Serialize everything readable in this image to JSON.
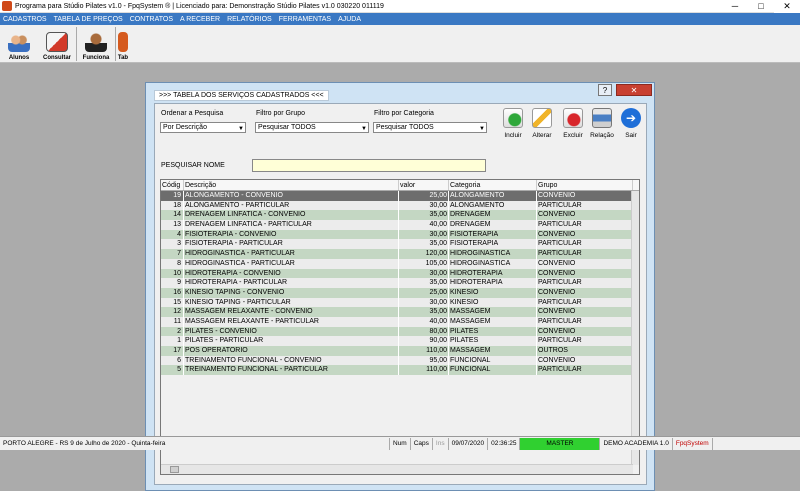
{
  "window": {
    "title": "Programa para Stúdio Pilates v1.0 - FpqSystem ® | Licenciado para: Demonstração Stúdio Pilates v1.0 030220 011119"
  },
  "menu": [
    "CADASTROS",
    "TABELA DE PREÇOS",
    "CONTRATOS",
    "A RECEBER",
    "RELATÓRIOS",
    "FERRAMENTAS",
    "AJUDA"
  ],
  "toolbar": [
    "Alunos",
    "Consultar",
    "Funciona",
    "Tab"
  ],
  "dialog": {
    "caption": ">>>  TABELA DOS SERVIÇOS CADASTRADOS  <<<",
    "help": "?",
    "close": "✕",
    "order_label": "Ordenar a Pesquisa",
    "order_value": "Por Descrição",
    "group_label": "Filtro por Grupo",
    "group_value": "Pesquisar TODOS",
    "category_label": "Filtro por Categoria",
    "category_value": "Pesquisar TODOS",
    "search_label": "PESQUISAR NOME",
    "search_value": "",
    "actions": [
      "Incluir",
      "Alterar",
      "Excluir",
      "Relação",
      "Sair"
    ]
  },
  "grid": {
    "columns": [
      "Códig",
      "Descrição",
      "valor",
      "Categoria",
      "Grupo"
    ],
    "rows": [
      {
        "code": "19",
        "desc": "ALONGAMENTO - CONVENIO",
        "value": "25,00",
        "cat": "ALONGAMENTO",
        "group": "CONVENIO"
      },
      {
        "code": "18",
        "desc": "ALONGAMENTO - PARTICULAR",
        "value": "30,00",
        "cat": "ALONGAMENTO",
        "group": "PARTICULAR"
      },
      {
        "code": "14",
        "desc": "DRENAGEM LINFATICA - CONVENIO",
        "value": "35,00",
        "cat": "DRENAGEM",
        "group": "CONVENIO"
      },
      {
        "code": "13",
        "desc": "DRENAGEM LINFATICA - PARTICULAR",
        "value": "40,00",
        "cat": "DRENAGEM",
        "group": "PARTICULAR"
      },
      {
        "code": "4",
        "desc": "FISIOTERAPIA - CONVENIO",
        "value": "30,00",
        "cat": "FISIOTERAPIA",
        "group": "CONVENIO"
      },
      {
        "code": "3",
        "desc": "FISIOTERAPIA - PARTICULAR",
        "value": "35,00",
        "cat": "FISIOTERAPIA",
        "group": "PARTICULAR"
      },
      {
        "code": "7",
        "desc": "HIDROGINASTICA - PARTICULAR",
        "value": "120,00",
        "cat": "HIDROGINASTICA",
        "group": "PARTICULAR"
      },
      {
        "code": "8",
        "desc": "HIDROGINASTICA - PARTICULAR",
        "value": "105,00",
        "cat": "HIDROGINASTICA",
        "group": "CONVENIO"
      },
      {
        "code": "10",
        "desc": "HIDROTERAPIA - CONVENIO",
        "value": "30,00",
        "cat": "HIDROTERAPIA",
        "group": "CONVENIO"
      },
      {
        "code": "9",
        "desc": "HIDROTERAPIA - PARTICULAR",
        "value": "35,00",
        "cat": "HIDROTERAPIA",
        "group": "PARTICULAR"
      },
      {
        "code": "16",
        "desc": "KINESIO TAPING - CONVENIO",
        "value": "25,00",
        "cat": "KINESIO",
        "group": "CONVENIO"
      },
      {
        "code": "15",
        "desc": "KINESIO TAPING - PARTICULAR",
        "value": "30,00",
        "cat": "KINESIO",
        "group": "PARTICULAR"
      },
      {
        "code": "12",
        "desc": "MASSAGEM RELAXANTE - CONVENIO",
        "value": "35,00",
        "cat": "MASSAGEM",
        "group": "CONVENIO"
      },
      {
        "code": "11",
        "desc": "MASSAGEM RELAXANTE - PARTICULAR",
        "value": "40,00",
        "cat": "MASSAGEM",
        "group": "PARTICULAR"
      },
      {
        "code": "2",
        "desc": "PILATES - CONVENIO",
        "value": "80,00",
        "cat": "PILATES",
        "group": "CONVENIO"
      },
      {
        "code": "1",
        "desc": "PILATES - PARTICULAR",
        "value": "90,00",
        "cat": "PILATES",
        "group": "PARTICULAR"
      },
      {
        "code": "17",
        "desc": "POS OPERATORIO",
        "value": "110,00",
        "cat": "MASSAGEM",
        "group": "OUTROS"
      },
      {
        "code": "6",
        "desc": "TREINAMENTO FUNCIONAL - CONVENIO",
        "value": "95,00",
        "cat": "FUNCIONAL",
        "group": "CONVENIO"
      },
      {
        "code": "5",
        "desc": "TREINAMENTO FUNCIONAL - PARTICULAR",
        "value": "110,00",
        "cat": "FUNCIONAL",
        "group": "PARTICULAR"
      }
    ]
  },
  "status": {
    "location": "PORTO ALEGRE - RS   9 de Julho de 2020 - Quinta-feira",
    "num": "Num",
    "caps": "Caps",
    "ins": "Ins",
    "date": "09/07/2020",
    "time": "02:36:25",
    "master": "MASTER",
    "edition": "DEMO ACADEMIA 1.0",
    "brand": "FpqSystem"
  }
}
